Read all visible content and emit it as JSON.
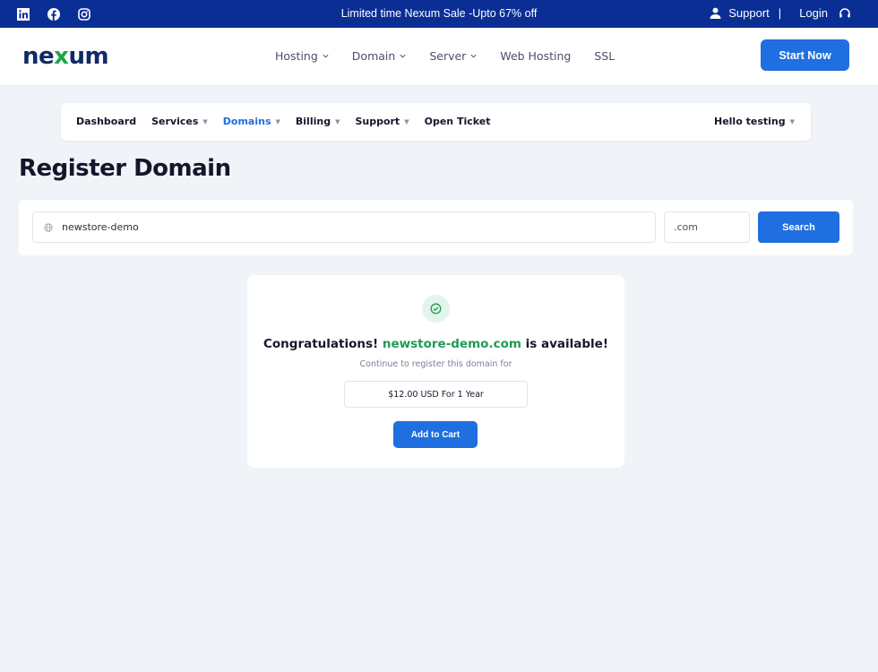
{
  "topbar": {
    "promo": "Limited time Nexum Sale -Upto 67% off",
    "support": "Support",
    "separator": "|",
    "login": "Login"
  },
  "header": {
    "logo_pre": "ne",
    "logo_x": "x",
    "logo_post": "um",
    "nav": [
      "Hosting",
      "Domain",
      "Server",
      "Web Hosting",
      "SSL"
    ],
    "start": "Start Now"
  },
  "clientnav": {
    "links": [
      "Dashboard",
      "Services",
      "Domains",
      "Billing",
      "Support",
      "Open Ticket"
    ],
    "user": "Hello testing"
  },
  "page": {
    "title": "Register Domain"
  },
  "search": {
    "value": "newstore-demo",
    "tld": ".com",
    "button": "Search"
  },
  "result": {
    "congrats": "Congratulations!",
    "domain": "newstore-demo.com",
    "available": "is available!",
    "subtitle": "Continue to register this domain for",
    "price": "$12.00 USD For 1 Year",
    "add": "Add to Cart"
  },
  "colors": {
    "primary": "#1f6fe0",
    "topbar": "#0a2e94",
    "success": "#1f9a55"
  }
}
